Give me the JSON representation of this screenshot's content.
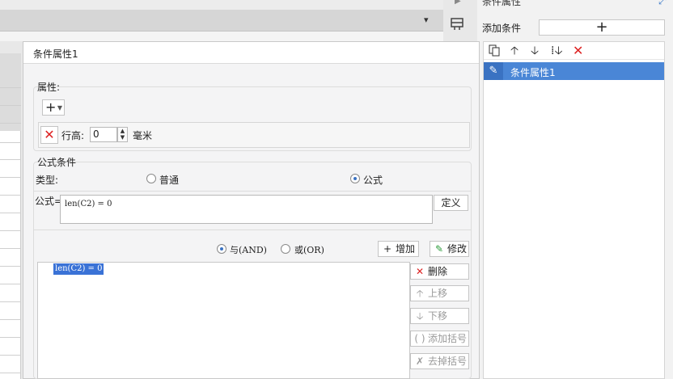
{
  "background": {
    "toolbar_collapse_glyph": "▾"
  },
  "right_panel": {
    "title": "条件属性",
    "add_condition_label": "添加条件",
    "add_button_glyph": "+",
    "toolbar_icons": [
      "copy-icon",
      "arrow-up-icon",
      "arrow-down-icon",
      "sort-down-icon",
      "delete-icon"
    ],
    "items": [
      {
        "label": "条件属性1",
        "selected": true
      }
    ]
  },
  "dialog": {
    "title": "条件属性1",
    "attributes": {
      "title": "属性:",
      "add_glyph": "+",
      "row": {
        "label": "行高:",
        "value": "0",
        "unit": "毫米"
      }
    },
    "formula_condition": {
      "title": "公式条件",
      "type_label": "类型:",
      "type_options": [
        {
          "label": "普通",
          "selected": false
        },
        {
          "label": "公式",
          "selected": true
        }
      ],
      "formula_label": "公式=",
      "formula_value": "len(C2) = 0",
      "define_button": "定义",
      "logic_options": [
        {
          "label": "与(AND)",
          "selected": true
        },
        {
          "label": "或(OR)",
          "selected": false
        }
      ],
      "add_button": "增加",
      "modify_button": "修改",
      "conditions": [
        "len(C2) = 0"
      ],
      "delete_button": "删除",
      "up_button": "上移",
      "down_button": "下移",
      "add_paren_button": "添加括号",
      "remove_paren_button": "去掉括号"
    }
  },
  "colors": {
    "selection_blue": "#4a86d6",
    "delete_red": "#d22222"
  }
}
